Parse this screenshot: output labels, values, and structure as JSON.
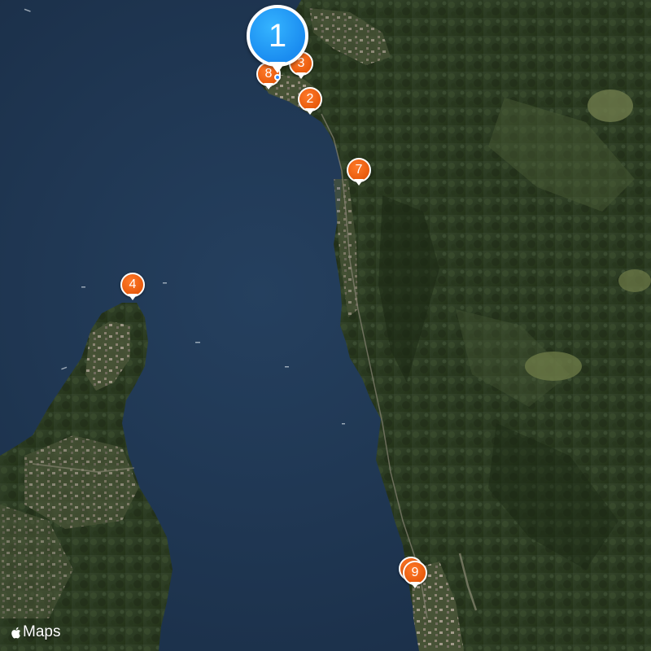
{
  "map": {
    "view": "satellite",
    "colors": {
      "lake": "#1f3550",
      "marker": "#ee6410",
      "selected_marker": "#1a8cf0",
      "marker_border": "#ffffff"
    }
  },
  "markers": [
    {
      "label": "1",
      "state": "selected"
    },
    {
      "label": "2",
      "state": "default"
    },
    {
      "label": "3",
      "state": "default"
    },
    {
      "label": "4",
      "state": "default"
    },
    {
      "label": "7",
      "state": "default"
    },
    {
      "label": "8",
      "state": "default"
    },
    {
      "label": "9",
      "state": "default"
    }
  ],
  "attribution": {
    "text": "Maps",
    "icon": "apple-logo-icon"
  }
}
